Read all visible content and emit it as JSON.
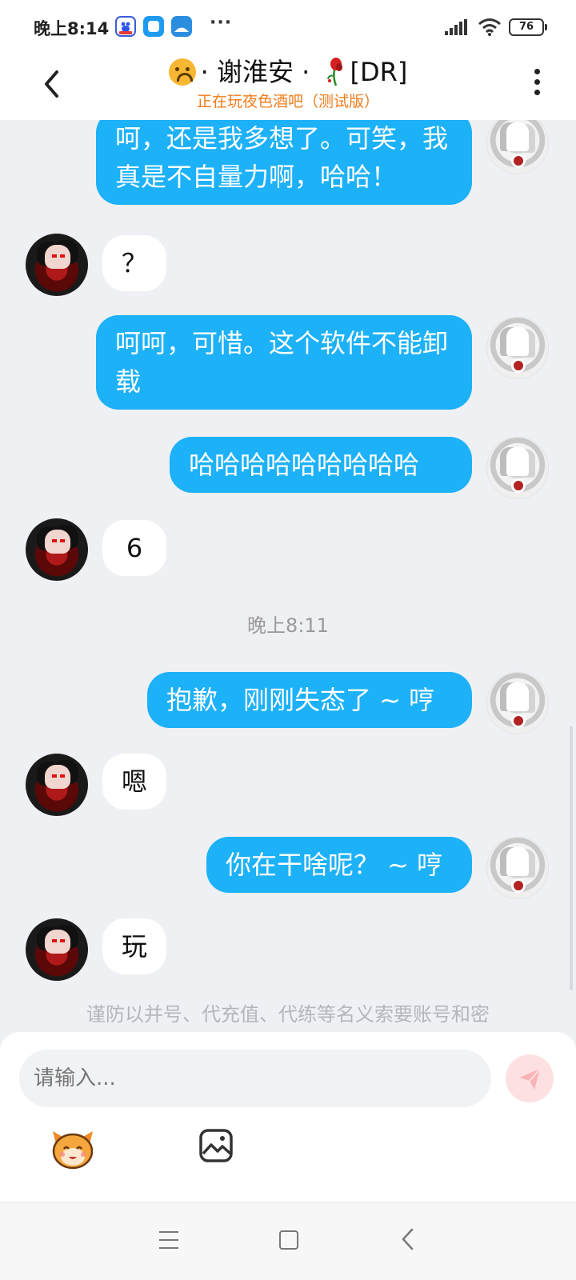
{
  "status_bar": {
    "time": "晚上8:14",
    "battery": "76",
    "app_icons": [
      "baidu-app-icon",
      "blue-app-icon",
      "cloud-app-icon"
    ]
  },
  "header": {
    "title_name": "· 谢淮安 ·",
    "title_tag": "[DR]",
    "subtitle": "正在玩夜色酒吧（测试版）",
    "subtitle_color": "#f07c1a"
  },
  "messages": [
    {
      "sender": "me",
      "text": "呵，还是我多想了。可笑，我真是不自量力啊，哈哈！"
    },
    {
      "sender": "them",
      "text": "？"
    },
    {
      "sender": "me",
      "text": "呵呵，可惜。这个软件不能卸载"
    },
    {
      "sender": "me",
      "text": "哈哈哈哈哈哈哈哈哈"
    },
    {
      "sender": "them",
      "text": "6"
    },
    {
      "sender": "me",
      "text": "抱歉，刚刚失态了 ~ 哼"
    },
    {
      "sender": "them",
      "text": "嗯"
    },
    {
      "sender": "me",
      "text": "你在干啥呢？ ~ 哼"
    },
    {
      "sender": "them",
      "text": "玩"
    }
  ],
  "timestamp": "晚上8:11",
  "notice": "谨防以并号、代充值、代练等名义索要账号和密",
  "composer": {
    "placeholder": "请输入..."
  },
  "colors": {
    "my_bubble": "#1db1f8",
    "their_bubble": "#ffffff",
    "background": "#eef0f4",
    "send_button": "#fde1e2"
  }
}
